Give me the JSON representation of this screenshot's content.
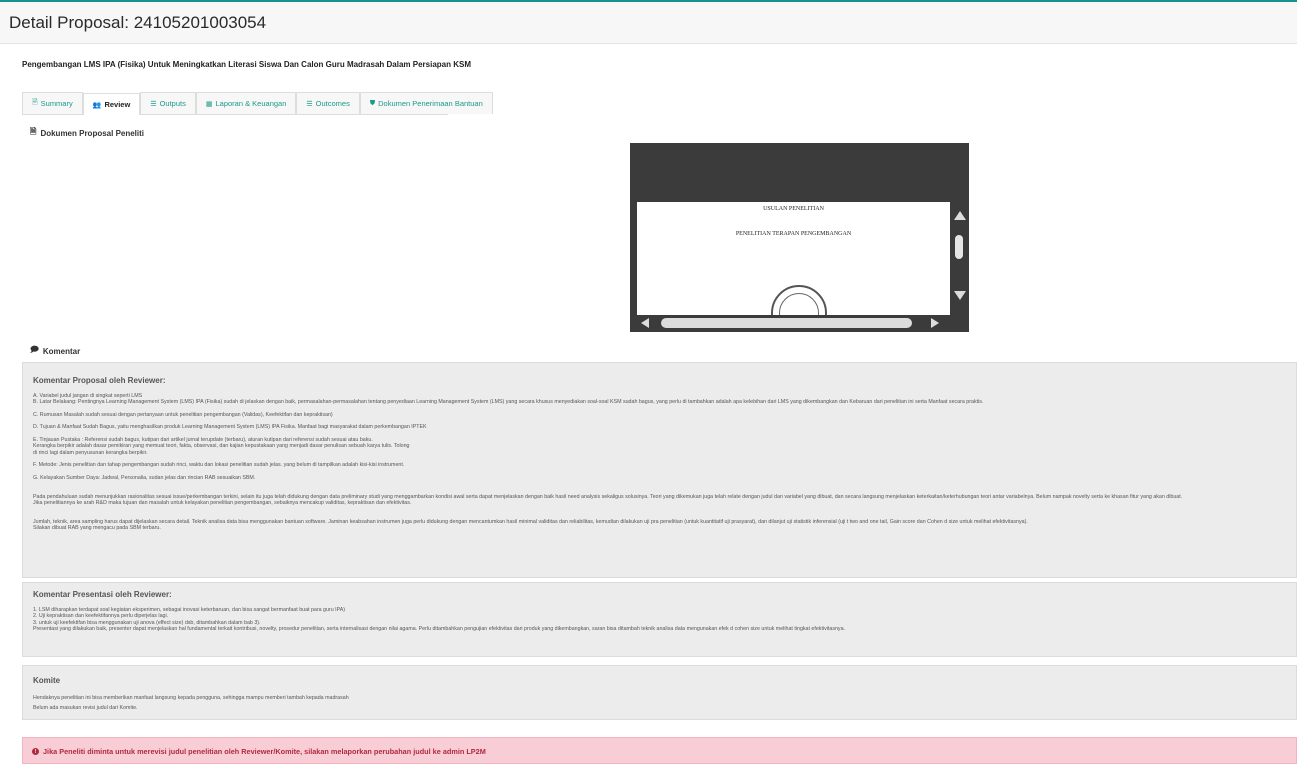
{
  "header": {
    "title": "Detail Proposal: 24105201003054"
  },
  "project_title": "Pengembangan LMS IPA (Fisika) Untuk Meningkatkan Literasi Siswa Dan Calon Guru Madrasah Dalam Persiapan KSM",
  "tabs": [
    {
      "label": "Summary",
      "icon": "document-icon",
      "glyph": "🗎",
      "active": false
    },
    {
      "label": "Review",
      "icon": "users-icon",
      "glyph": "👥",
      "active": true
    },
    {
      "label": "Outputs",
      "icon": "list-icon",
      "glyph": "☰",
      "active": false
    },
    {
      "label": "Laporan & Keuangan",
      "icon": "money-icon",
      "glyph": "▦",
      "active": false
    },
    {
      "label": "Outcomes",
      "icon": "list-alt-icon",
      "glyph": "☰",
      "active": false
    },
    {
      "label": "Dokumen Penerimaan Bantuan",
      "icon": "shield-icon",
      "glyph": "⛊",
      "active": false
    }
  ],
  "documents_section": {
    "label": "Dokumen Proposal Peneliti",
    "icon": "document-icon"
  },
  "pdf_viewer": {
    "line1": "USULAN PENELITIAN",
    "line2": "PENELITIAN TERAPAN PENGEMBANGAN"
  },
  "comments_section": {
    "label": "Komentar",
    "icon": "comment-icon"
  },
  "reviewer_proposal": {
    "title": "Komentar Proposal oleh Reviewer:",
    "lines": [
      "A. Variabel judul jangan di singkat seperti LMS",
      "B. Latar Belakang: Pentingnya Learning Management System (LMS) IPA (Fisika) sudah di jelaskan dengan baik, permasalahan-permasalahan tentang penyediaan Learning Management System (LMS) yang secara khusus menyediakan soal-soal KSM sudah bagus, yang perlu di tambahkan adalah apa kelebihan dari LMS yang dikembangkan dan Kebaruan dari penelitian ini serta Manfaat secara praktis.",
      "",
      "C. Rumusan Masalah sudah sesuai dengan pertanyaan untuk penelitian pengembangan (Validas), Keefektifan dan kepraktisan)",
      "",
      "D. Tujuan & Manfaat Sudah Bagus, yaitu menghasilkan produk Learning Management System (LMS) IPA Fisika. Manfaat bagi masyarakat dalam perkembangan IPTEK",
      "",
      "E. Tinjauan Pustaka : Referensi sudah bagus, kutipan dari artikel jurnal terupdate (terbaru), aturan kutipan dari referensi sudah sesuai atau baku.",
      "Kerangka berpikir adalah dasar pemikiran yang memuat teori, fakta, observasi, dan kajian kepustakaan yang menjadi dasar penulisan sebuah karya tulis. Tolong",
      "di rinci lagi dalam penyusunan kerangka berpikir.",
      "",
      "F. Metode: Jenis penelitian dan tahap pengembangan sudah rinci, waktu dan lokasi penelitian sudah jelas. yang belum di tampilkan adalah kisi-kisi instrument.",
      "",
      "G. Kelayakan Sumber Daya: Jadwal, Personalia, sudan jelas dan rincian RAB sesuaikan SBM.",
      "",
      "",
      "Pada pendahuluan sudah menunjukkan rasionalitas sesuai issue/perkembangan terkini, selain itu juga telah didukung dengan data preliminary studi yang menggambarkan kondisi awal serta dapat menjelaskan dengan baik hasil need analysis sekaligus solusinya. Teori yang dikemukan juga telah relate dengan judul dan variabel yang dibuat, dan secara langsung menjelaskan keterkaitan/keterhubungan teori antar variabelnya. Belum nampak novelty serta ke khasan fitur yang akan dibuat.",
      "Jika penelitiannya ke arah R&D maka tujuan dan masalah untuk kelayakan penelitian pengembangan, sebaiknya mencakup validitas, kepraktisan dan efektivitas.",
      "",
      "",
      "Jumlah, teknik, area sampling harus dapat dijelaskan secara detail. Teknik analisa data bisa menggunakan bantuan software. Jaminan keabsahan instrumen juga perlu didukung dengan mencantumkan hasil minimal validitas dan reliabilitas, kemudian dilakukan uji pra penelitian (untuk kuantitatif uji prasyarat), dan dilanjut uji statistik inferensial (uji t two and one tail, Gain score dan Cohen d size untuk melihat efektivitasnya).",
      "Silakan dibuat RAB yang mengacu pada SBM terbaru."
    ]
  },
  "reviewer_presentation": {
    "title": "Komentar Presentasi oleh Reviewer:",
    "lines": [
      "1. LSM diharapkan terdapat soal kegiatan eksperimen, sebagai inovasi keterbaruan, dan bisa sangat bermanfaat buat para guru IPA)",
      "2. Uji kepraktisan dan keefektifannya perlu diperjelas lagi.",
      "3. untuk uji keefektifan bisa menggunakan uji anova (effect size) dsb, ditambahkan dalam bab 3).",
      "Presentasi yang dilakukan baik, presenter dapat menjelaskan hal fundamental terkait kontribusi, novelty, prosedur penelitian, serta internalisasi dengan nilai agama. Perlu ditambahkan pengujian efektivitas dari produk yang dikembangkan, saran bisa ditambah teknik analisa data mengunakan efek d cohen size untuk melihat tingkat efektivitasnya."
    ]
  },
  "committee": {
    "title": "Komite",
    "lines": [
      "Hendaknya penelitian ini bisa memberikan manfaat langsung kepada pengguna, sehingga mampu memberi tambah kepada madrasah",
      "Belum ada masukan revisi judul dari Komite."
    ]
  },
  "alert": {
    "text": "Jika Peneliti diminta untuk merevisi judul penelitian oleh Reviewer/Komite, silakan melaporkan perubahan judul ke admin LP2M"
  }
}
